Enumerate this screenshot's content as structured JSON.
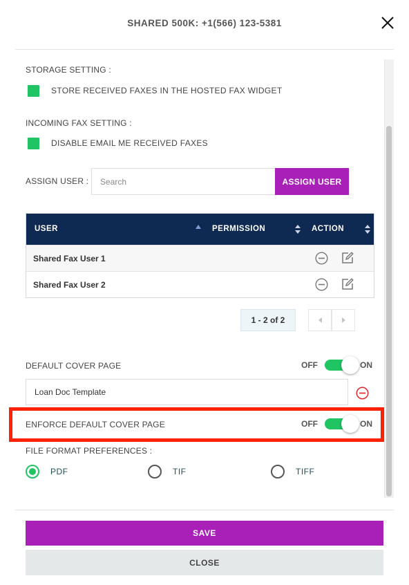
{
  "header": {
    "title": "SHARED 500K: +1(566) 123-5381",
    "close_icon": "close-icon"
  },
  "storage": {
    "label": "STORAGE SETTING :",
    "checkbox_label": "STORE RECEIVED FAXES IN THE HOSTED FAX WIDGET",
    "checked": true
  },
  "incoming": {
    "label": "INCOMING FAX SETTING :",
    "checkbox_label": "DISABLE EMAIL ME RECEIVED FAXES",
    "checked": true
  },
  "assign": {
    "label": "ASSIGN USER :",
    "search_placeholder": "Search",
    "button_label": "ASSIGN USER"
  },
  "table": {
    "columns": [
      "USER",
      "PERMISSION",
      "ACTION"
    ],
    "rows": [
      {
        "user": "Shared Fax User 1"
      },
      {
        "user": "Shared Fax User 2"
      }
    ]
  },
  "pagination": {
    "info": "1 - 2 of 2"
  },
  "default_cover": {
    "label": "DEFAULT COVER PAGE",
    "off_label": "OFF",
    "on_label": "ON",
    "state": "on",
    "template_value": "Loan Doc Template"
  },
  "enforce_cover": {
    "label": "ENFORCE DEFAULT COVER PAGE",
    "off_label": "OFF",
    "on_label": "ON",
    "state": "on"
  },
  "file_format": {
    "label": "FILE FORMAT PREFERENCES :",
    "options": [
      "PDF",
      "TIF",
      "TIFF"
    ],
    "selected": "PDF"
  },
  "footer": {
    "save_label": "SAVE",
    "close_label": "CLOSE"
  },
  "colors": {
    "accent_purple": "#a920b8",
    "green": "#20c463",
    "navy": "#0e2a52",
    "highlight_red": "#ff2200"
  }
}
